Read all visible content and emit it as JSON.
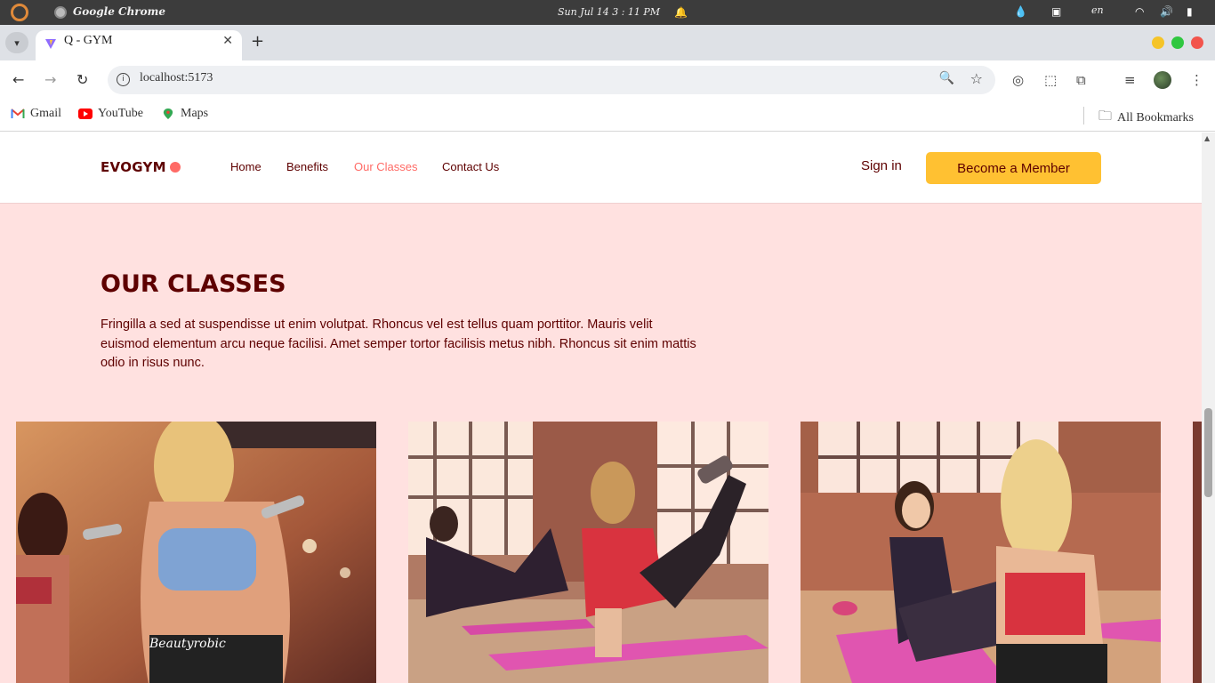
{
  "os": {
    "app_name": "Google Chrome",
    "clock": "Sun Jul 14   3 : 11 PM",
    "lang": "en"
  },
  "browser": {
    "tab_title": "Q - GYM",
    "url": "localhost:5173",
    "bookmarks": [
      "Gmail",
      "YouTube",
      "Maps"
    ],
    "all_bookmarks": "All Bookmarks"
  },
  "site": {
    "logo": "EVOGYM",
    "nav": {
      "home": "Home",
      "benefits": "Benefits",
      "classes": "Our Classes",
      "contact": "Contact Us"
    },
    "sign_in": "Sign in",
    "cta": "Become a Member"
  },
  "classes": {
    "title": "OUR CLASSES",
    "description": "Fringilla a sed at suspendisse ut enim volutpat. Rhoncus vel est tellus quam porttitor. Mauris velit euismod elementum arcu neque facilisi. Amet semper tortor facilisis metus nibh. Rhoncus sit enim mattis odio in risus nunc.",
    "image_logo_text": "Beautyrobic"
  },
  "colors": {
    "primary": "#5e0000",
    "accent": "#ff6b66",
    "cta": "#ffc132",
    "background": "#ffe1e0"
  }
}
